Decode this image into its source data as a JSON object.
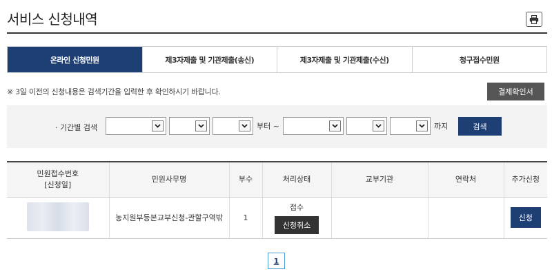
{
  "header": {
    "title": "서비스 신청내역",
    "print_icon": "printer-icon"
  },
  "tabs": [
    {
      "label": "온라인 신청민원",
      "active": true
    },
    {
      "label": "제3자제출 및 기관제출(송신)",
      "active": false
    },
    {
      "label": "제3자제출 및 기관제출(수신)",
      "active": false
    },
    {
      "label": "청구접수민원",
      "active": false
    }
  ],
  "notice": "※ 3일 이전의 신청내용은 검색기간을 입력한 후 확인하시기 바랍니다.",
  "confirm_button": "결제확인서",
  "search": {
    "label": "· 기간별 검색",
    "from_year": "",
    "from_month": "",
    "from_day": "",
    "from_suffix": "부터 ~",
    "to_year": "",
    "to_month": "",
    "to_day": "",
    "to_suffix": "까지",
    "button": "검색"
  },
  "table": {
    "headers": [
      "민원접수번호",
      "[신청일]",
      "민원사무명",
      "부수",
      "처리상태",
      "교부기관",
      "연락처",
      "추가신청"
    ],
    "rows": [
      {
        "service_name": "농지원부등본교부신청-관할구역밖",
        "copies": "1",
        "status": "접수",
        "cancel_label": "신청취소",
        "issuing_agency": "",
        "contact": "",
        "apply_label": "신청"
      }
    ]
  },
  "pagination": {
    "current": "1"
  },
  "colors": {
    "primary": "#1e3f74",
    "dark_button": "#333333",
    "confirm_button": "#555555"
  }
}
